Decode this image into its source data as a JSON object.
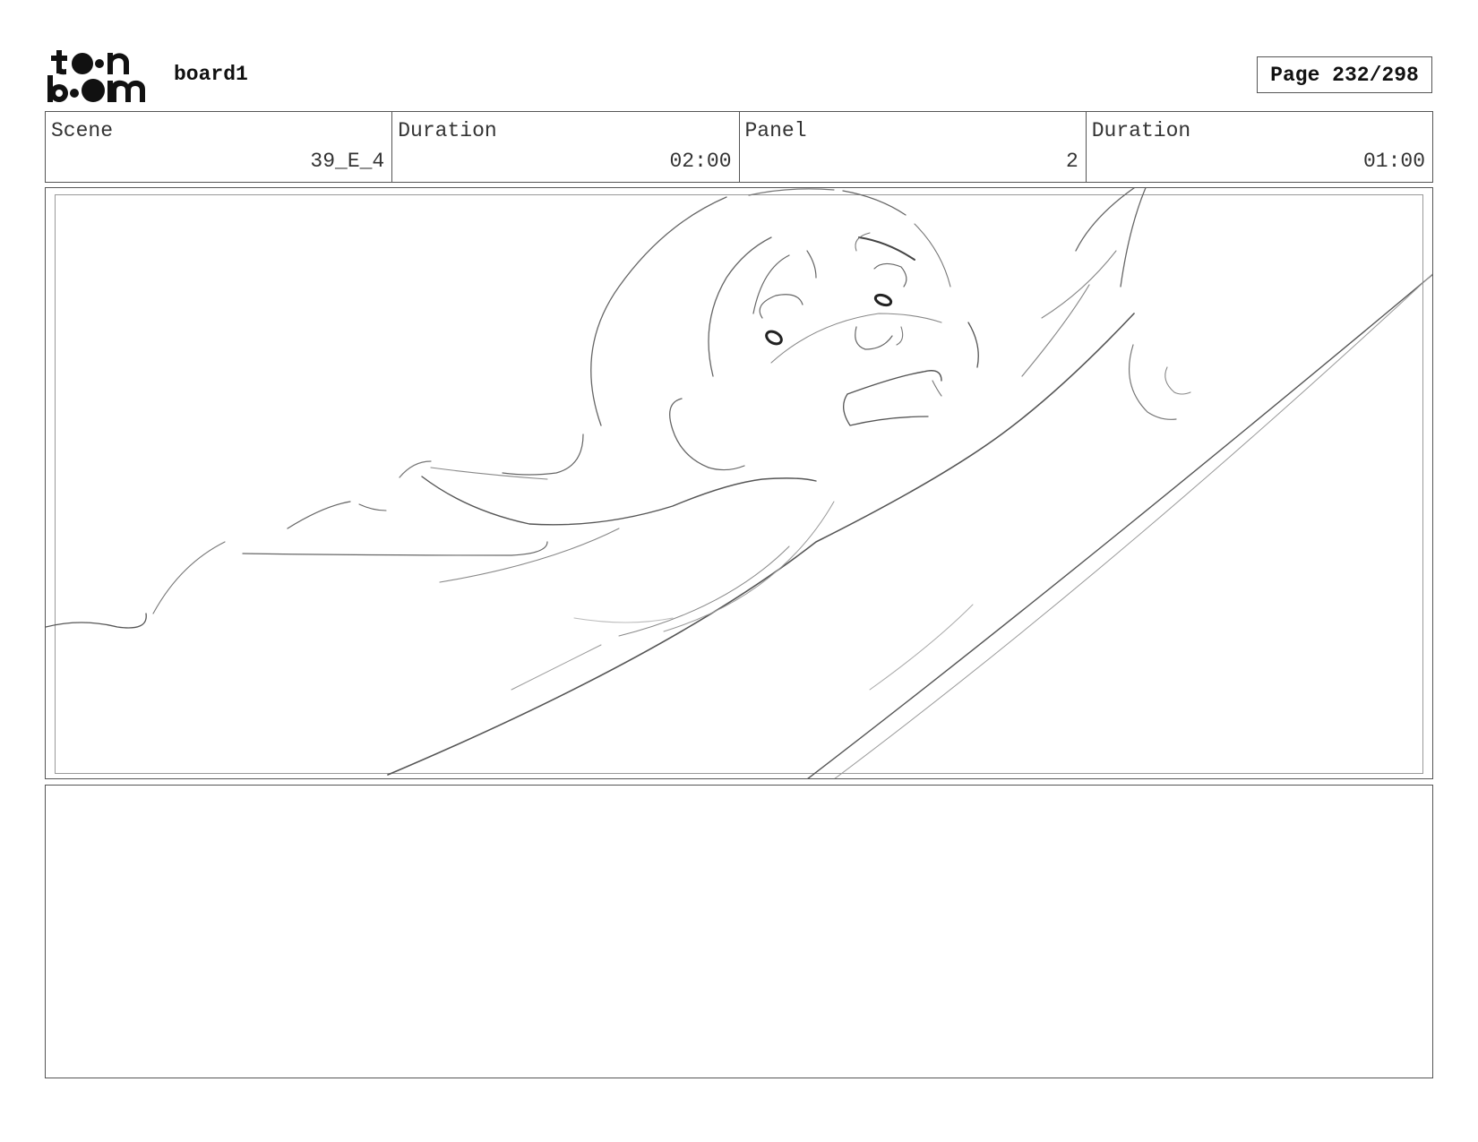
{
  "header": {
    "logo_text": "toon boom",
    "board_name": "board1",
    "page_label": "Page 232/298"
  },
  "info": [
    {
      "label": "Scene",
      "value": "39_E_4"
    },
    {
      "label": "Duration",
      "value": "02:00"
    },
    {
      "label": "Panel",
      "value": "2"
    },
    {
      "label": "Duration",
      "value": "01:00"
    }
  ],
  "panel": {
    "sketch_icon": "storyboard-sketch-character-reaching"
  },
  "notes": {
    "text": ""
  }
}
